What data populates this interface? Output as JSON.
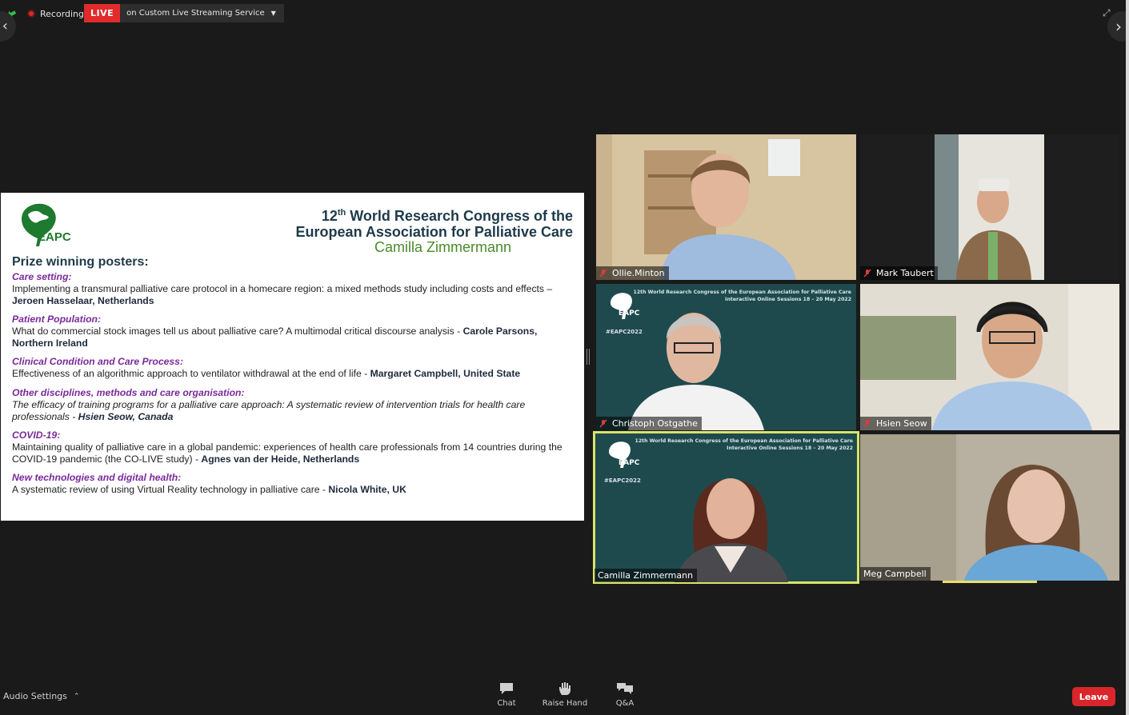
{
  "top_bar": {
    "recording_label": "Recording",
    "live_badge": "LIVE",
    "live_service": "on Custom Live Streaming Service"
  },
  "slide": {
    "congress_title_pre": "12",
    "congress_title_sup": "th",
    "congress_title_line1_rest": " World Research Congress of the",
    "congress_title_line2": "European Association for Palliative Care",
    "presenter": "Camilla Zimmermann",
    "logo_text": "EAPC",
    "heading": "Prize winning posters:",
    "entries": [
      {
        "category": "Care setting:",
        "text": "Implementing a transmural palliative care protocol in a homecare region: a mixed methods study including costs and effects – ",
        "author": "Jeroen Hasselaar, Netherlands"
      },
      {
        "category": "Patient Population:",
        "text": "What do commercial stock images tell us about palliative care? A multimodal critical discourse analysis - ",
        "author": "Carole Parsons, Northern Ireland"
      },
      {
        "category": "Clinical Condition and Care Process:",
        "text": "Effectiveness of an algorithmic approach to ventilator withdrawal at the end of life - ",
        "author": "Margaret Campbell, United State"
      },
      {
        "category": "Other disciplines, methods and care organisation:",
        "text": "The efficacy of training programs for a palliative care approach: A systematic review of intervention trials for health care professionals - ",
        "author": "Hsien Seow, Canada"
      },
      {
        "category": "COVID-19:",
        "text": "Maintaining quality of palliative care in a global pandemic: experiences of health care professionals from 14 countries during the COVID-19 pandemic (the CO-LIVE study) - ",
        "author": "Agnes van der Heide, Netherlands"
      },
      {
        "category": "New technologies and digital health:",
        "text": "A systematic review of using Virtual Reality technology in palliative care - ",
        "author": "Nicola White, UK"
      }
    ]
  },
  "participants": [
    {
      "name": "Ollie.Minton",
      "muted": true
    },
    {
      "name": "Mark Taubert",
      "muted": true
    },
    {
      "name": "Christoph Ostgathe",
      "muted": true
    },
    {
      "name": "Hsien Seow",
      "muted": true
    },
    {
      "name": "Camilla Zimmermann",
      "muted": false,
      "active_speaker": true
    },
    {
      "name": "Meg Campbell",
      "muted": false
    }
  ],
  "virtual_bg": {
    "header_line1": "12th World Research Congress of the European Association for Palliative Care",
    "header_line2": "Interactive Online Sessions 18 – 20 May 2022",
    "hashtag": "#EAPC2022",
    "logo_text": "EAPC"
  },
  "bottom_bar": {
    "audio_settings": "Audio Settings",
    "chat": "Chat",
    "raise_hand": "Raise Hand",
    "qa": "Q&A",
    "leave": "Leave"
  },
  "colors": {
    "live_red": "#e12b2b",
    "leave_red": "#d8262a",
    "active_speaker_outline": "#d9e36a",
    "eapc_green": "#1e7a2e",
    "category_purple": "#7a2a9a",
    "tile_bg_teal": "#1e4a4e"
  }
}
